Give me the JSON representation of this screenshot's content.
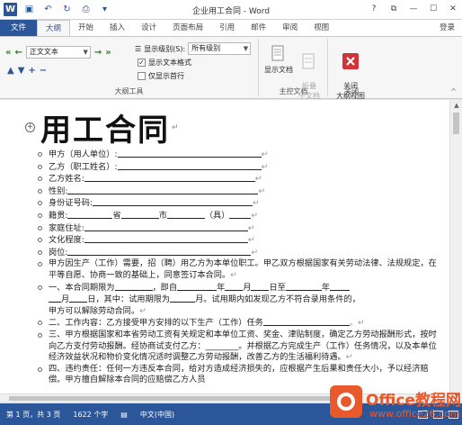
{
  "window": {
    "title": "企业用工合同 - Word",
    "controls": [
      "?",
      "⧉",
      "—",
      "☐",
      "✕"
    ]
  },
  "tabs": {
    "file": "文件",
    "items": [
      "大纲",
      "开始",
      "插入",
      "设计",
      "页面布局",
      "引用",
      "邮件",
      "审阅",
      "视图"
    ],
    "login": "登录"
  },
  "ribbon": {
    "outline_group": {
      "label": "大纲工具",
      "level_value": "正文文本",
      "show_level_label": "显示级别(S):",
      "show_level_value": "所有级别",
      "show_text_format": "显示文本格式",
      "show_first_line": "仅显示首行"
    },
    "master_group": {
      "label": "主控文档",
      "show_doc": "显示文档",
      "collapse_doc": "折叠\n子文档"
    },
    "close_group": {
      "label": "关闭",
      "close_outline": "关闭\n大纲视图"
    }
  },
  "document": {
    "heading": "用工合同",
    "lines": [
      {
        "label": "甲方（用人单位）:"
      },
      {
        "label": "乙方（职工姓名）:"
      },
      {
        "label": "乙方姓名:"
      },
      {
        "label": "性别:"
      },
      {
        "label": "身份证号码:"
      },
      {
        "label": "籍贯:",
        "t1": "省",
        "t2": "市",
        "t3": "（具）"
      },
      {
        "label": "家庭住址:"
      },
      {
        "label": "文化程度:"
      },
      {
        "label": "岗位:"
      },
      {
        "text": "甲方因生产（工作）需要，招（聘）用乙方为本单位职工。甲乙双方根据国家有关劳动法律、法规规定，在平等自愿、协商一致的基础上，同意签订本合同。"
      },
      {
        "p1": "一、本合同期限为",
        "p2": "，即自",
        "p3": "年",
        "p4": "月",
        "p5": "日至",
        "p6": "年"
      },
      {
        "p1": "月",
        "p2": "日，其中：试用期限为",
        "p3": "月。试用期内如发现乙方不符合录用条件的，"
      },
      {
        "text": "甲方可以解除劳动合同。"
      },
      {
        "p1": "二、工作内容：乙方接受甲方安排的以下生产（工作）任务"
      },
      {
        "text": "三、甲方根据国家和本省劳动工资有关规定和本单位工资、奖金、津贴制度，确定乙方劳动报酬形式，按时向乙方支付劳动报酬。经协商试支付乙方：________。并根据乙方完成生产（工作）任务情况，以及本单位经济效益状况和物价变化情况适时调整乙方劳动报酬，改善乙方的生活福利待遇。"
      },
      {
        "text": "四、违约责任：任何一方违反本合同，给对方造成经济损失的，应根据产生后果和责任大小，予以经济赔偿。甲方擅自解除本合同的应赔偿乙方人员"
      }
    ]
  },
  "status": {
    "page": "第 1 页，共 3 页",
    "words": "1622 个字",
    "lang": "中文(中国)"
  },
  "watermark": {
    "brand": "Office教程网",
    "url": "www.office26.com"
  },
  "colors": {
    "accent": "#2b579a",
    "watermark": "#e8592c",
    "close_button": "#d13438"
  }
}
